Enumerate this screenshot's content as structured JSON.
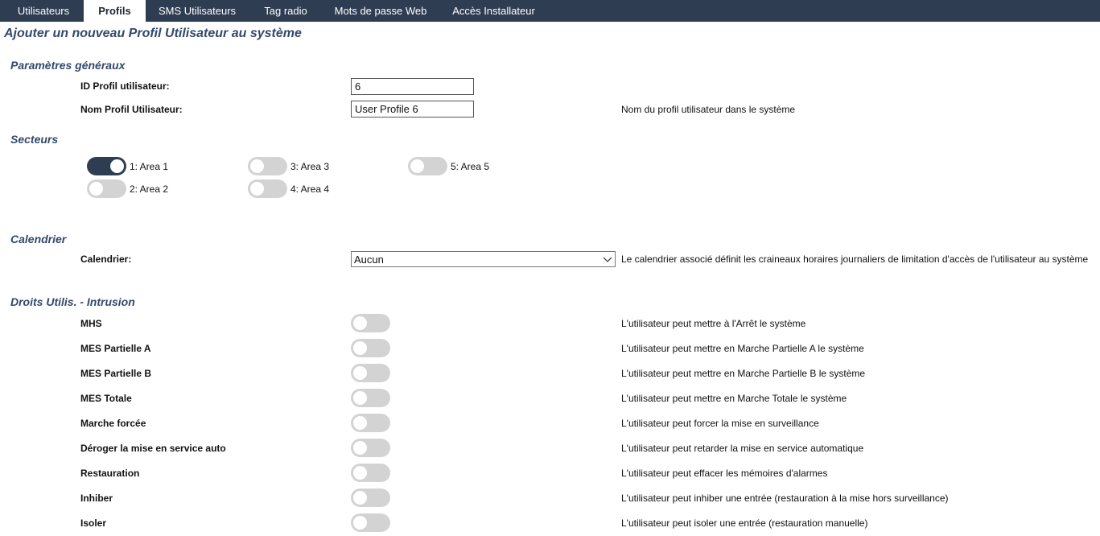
{
  "tabs": [
    {
      "label": "Utilisateurs",
      "active": false
    },
    {
      "label": "Profils",
      "active": true
    },
    {
      "label": "SMS Utilisateurs",
      "active": false
    },
    {
      "label": "Tag radio",
      "active": false
    },
    {
      "label": "Mots de passe Web",
      "active": false
    },
    {
      "label": "Accès Installateur",
      "active": false
    }
  ],
  "page_title": "Ajouter un nouveau Profil Utilisateur au système",
  "general": {
    "title": "Paramètres généraux",
    "id_label": "ID Profil utilisateur:",
    "id_value": "6",
    "name_label": "Nom Profil Utilisateur:",
    "name_value": "User Profile 6",
    "name_desc": "Nom du profil utilisateur dans le système"
  },
  "sectors": {
    "title": "Secteurs",
    "areas": [
      {
        "label": "1: Area 1",
        "on": true
      },
      {
        "label": "2: Area 2",
        "on": false
      },
      {
        "label": "3: Area 3",
        "on": false
      },
      {
        "label": "4: Area 4",
        "on": false
      },
      {
        "label": "5: Area 5",
        "on": false
      }
    ]
  },
  "calendar": {
    "title": "Calendrier",
    "label": "Calendrier:",
    "value": "Aucun",
    "desc": "Le calendrier associé définit les craineaux horaires journaliers de limitation d'accès de l'utilisateur au système",
    "icon": "chevron-down-icon"
  },
  "rights": {
    "title": "Droits Utilis. - Intrusion",
    "items": [
      {
        "label": "MHS",
        "desc": "L'utilisateur peut mettre à l'Arrêt le système",
        "on": false
      },
      {
        "label": "MES Partielle A",
        "desc": "L'utilisateur peut mettre en Marche Partielle A le système",
        "on": false
      },
      {
        "label": "MES Partielle B",
        "desc": "L'utilisateur peut mettre en Marche Partielle B le système",
        "on": false
      },
      {
        "label": "MES Totale",
        "desc": "L'utilisateur peut mettre en Marche Totale le système",
        "on": false
      },
      {
        "label": "Marche forcée",
        "desc": "L'utilisateur peut forcer la mise en surveillance",
        "on": false
      },
      {
        "label": "Déroger la mise en service auto",
        "desc": "L'utilisateur peut retarder la mise en service automatique",
        "on": false
      },
      {
        "label": "Restauration",
        "desc": "L'utilisateur peut effacer les mémoires d'alarmes",
        "on": false
      },
      {
        "label": "Inhiber",
        "desc": "L'utilisateur peut inhiber une entrée (restauration à la mise hors surveillance)",
        "on": false
      },
      {
        "label": "Isoler",
        "desc": "L'utilisateur peut isoler une entrée (restauration manuelle)",
        "on": false
      }
    ]
  },
  "colors": {
    "header_bg": "#2f3d52",
    "section_title": "#34496b",
    "toggle_on": "#2f3d52",
    "toggle_off": "#d3d3d3"
  }
}
